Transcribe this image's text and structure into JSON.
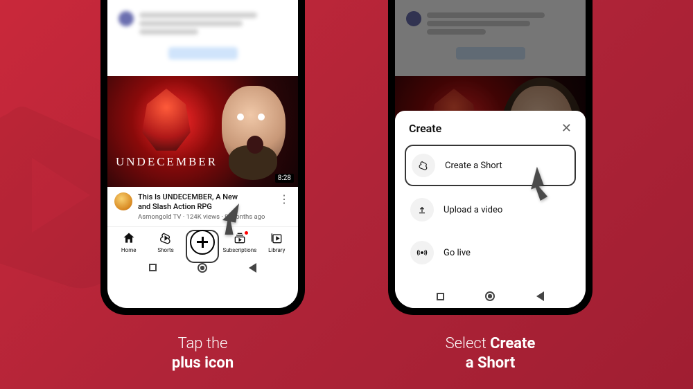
{
  "captions": {
    "left_a": "Tap the",
    "left_b": "plus icon",
    "right_a": "Select ",
    "right_b_bold": "Create",
    "right_c_bold": "a Short"
  },
  "video": {
    "overlay_title": "UNDECEMBER",
    "duration": "8:28",
    "title_prefix": "This Is UNDECEMBER, A New ",
    "title_suffix": " and Slash Action RPG",
    "subline": "Asmongold TV · 124K views · 9 months ago"
  },
  "nav": {
    "home": "Home",
    "shorts": "Shorts",
    "subscriptions": "Subscriptions",
    "library": "Library"
  },
  "sheet": {
    "title": "Create",
    "items": {
      "short": "Create a Short",
      "upload": "Upload a video",
      "live": "Go live"
    }
  }
}
